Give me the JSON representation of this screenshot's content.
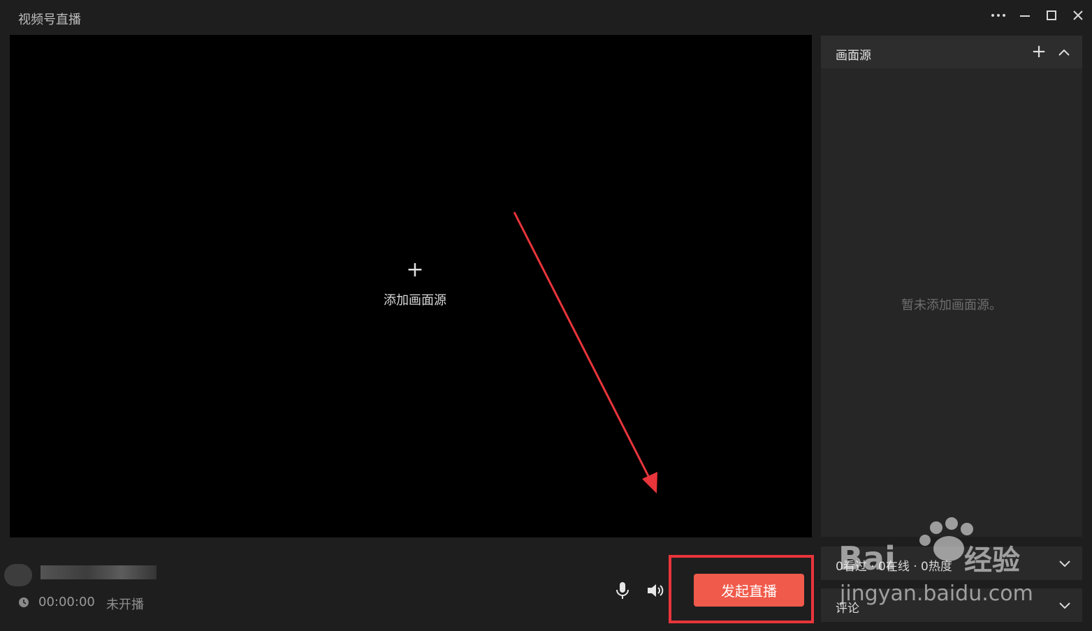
{
  "window": {
    "title": "视频号直播"
  },
  "titlebar_icons": [
    "more-icon",
    "minimize-icon",
    "maximize-icon",
    "close-icon"
  ],
  "preview": {
    "add_label": "添加画面源",
    "add_icon": "plus-icon"
  },
  "source_panel": {
    "title": "画面源",
    "empty_text": "暂未添加画面源。"
  },
  "stats_bar": {
    "label": "0看过 · 0在线 · 0热度"
  },
  "comments_bar": {
    "label": "评论"
  },
  "footer": {
    "timer": "00:00:00",
    "status": "未开播"
  },
  "actions": {
    "start_live": "发起直播"
  },
  "colors": {
    "accent": "#f05a4a",
    "annotation": "#e8353b"
  }
}
